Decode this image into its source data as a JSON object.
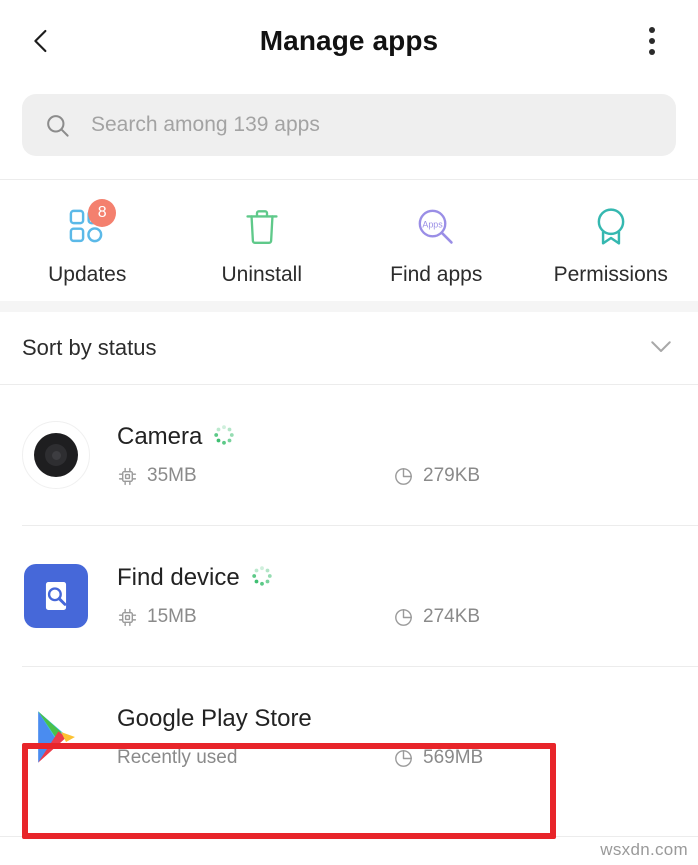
{
  "appbar": {
    "title": "Manage apps",
    "back_icon": "chevron-left-icon",
    "more_icon": "overflow-menu-icon"
  },
  "search": {
    "icon": "search-icon",
    "placeholder": "Search among 139 apps",
    "value": "",
    "app_count": "139"
  },
  "quick_actions": [
    {
      "label": "Updates",
      "icon": "app-grid-icon",
      "badge": "8",
      "icon_color": "#5bb9e8",
      "badge_color": "#f4806e"
    },
    {
      "label": "Uninstall",
      "icon": "trash-icon",
      "badge": "",
      "icon_color": "#5fc98a",
      "badge_color": ""
    },
    {
      "label": "Find apps",
      "icon": "find-apps-magnifier-icon",
      "badge": "",
      "icon_color": "#9a8ee6",
      "badge_color": "",
      "inner_text": "Apps"
    },
    {
      "label": "Permissions",
      "icon": "award-ribbon-icon",
      "badge": "",
      "icon_color": "#35b8b0",
      "badge_color": ""
    }
  ],
  "sort": {
    "label": "Sort by status",
    "chevron_icon": "chevron-down-icon"
  },
  "apps": [
    {
      "name": "Camera",
      "icon": "camera-lens-icon",
      "status_icon": "loading-spinner-icon",
      "subtitle": "",
      "ram_icon": "cpu-chip-icon",
      "ram": "35MB",
      "storage_icon": "storage-pie-icon",
      "storage": "279KB",
      "highlighted": false
    },
    {
      "name": "Find device",
      "icon": "find-device-icon",
      "status_icon": "loading-spinner-icon",
      "subtitle": "",
      "ram_icon": "cpu-chip-icon",
      "ram": "15MB",
      "storage_icon": "storage-pie-icon",
      "storage": "274KB",
      "highlighted": false
    },
    {
      "name": "Google Play Store",
      "icon": "google-play-icon",
      "status_icon": "",
      "subtitle": "Recently used",
      "ram_icon": "",
      "ram": "",
      "storage_icon": "storage-pie-icon",
      "storage": "569MB",
      "highlighted": true
    }
  ],
  "highlight": {
    "color": "#e8252a"
  },
  "watermark": "wsxdn.com"
}
